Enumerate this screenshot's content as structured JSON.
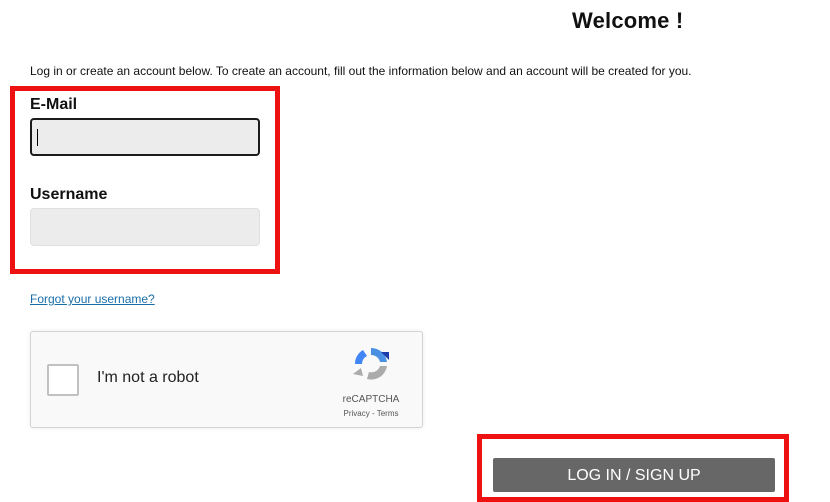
{
  "header": {
    "title": "Welcome !"
  },
  "intro_text": "Log in or create an account below. To create an account, fill out the information below and an account will be created for you.",
  "form": {
    "email": {
      "label": "E-Mail",
      "value": ""
    },
    "username": {
      "label": "Username",
      "value": ""
    },
    "forgot_link": "Forgot your username?"
  },
  "recaptcha": {
    "label": "I'm not a robot",
    "brand": "reCAPTCHA",
    "links": "Privacy - Terms",
    "checked": false,
    "icon": "recaptcha-logo-icon"
  },
  "submit_label": "LOG IN / SIGN UP",
  "colors": {
    "highlight": "#ee1111",
    "button_bg": "#676767",
    "link": "#1a6ea8",
    "input_bg": "#ececec"
  }
}
